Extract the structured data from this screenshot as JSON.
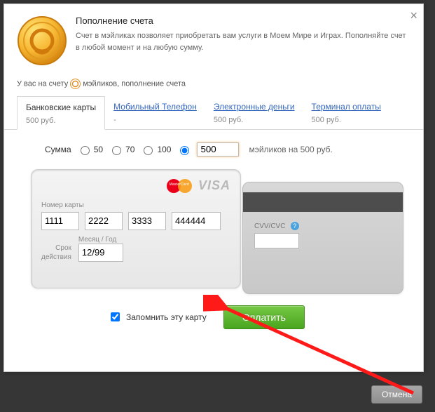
{
  "header": {
    "title": "Пополнение счета",
    "subtitle": "Счет в мэйликах позволяет приобретать вам услуги в Моем Мире и Играх. Пополняйте счет в любой момент и на любую сумму."
  },
  "balance": {
    "prefix": "У вас на счету",
    "amount_hidden": "",
    "suffix": "мэйликов, пополнение счета"
  },
  "tabs": [
    {
      "title": "Банковские карты",
      "sub": "500 руб.",
      "active": true
    },
    {
      "title": "Мобильный Телефон",
      "sub": "-",
      "active": false
    },
    {
      "title": "Электронные деньги",
      "sub": "500 руб.",
      "active": false
    },
    {
      "title": "Терминал оплаты",
      "sub": "500 руб.",
      "active": false
    }
  ],
  "sum": {
    "label": "Сумма",
    "options": [
      "50",
      "70",
      "100"
    ],
    "custom_value": "500",
    "hint": "мэйликов на 500 руб."
  },
  "card": {
    "number_label": "Номер карты",
    "n1": "1111",
    "n2": "2222",
    "n3": "3333",
    "n4": "444444",
    "exp_group_label": "Месяц / Год",
    "exp_side_label1": "Срок",
    "exp_side_label2": "действия",
    "exp_value": "12/99",
    "cvv_label": "CVV/CVC",
    "cvv_value": ""
  },
  "brands": {
    "mastercard": "MasterCard",
    "visa": "VISA"
  },
  "remember_label": "Запомнить эту карту",
  "remember_checked": true,
  "pay_label": "Оплатить",
  "cancel_label": "Отмена"
}
